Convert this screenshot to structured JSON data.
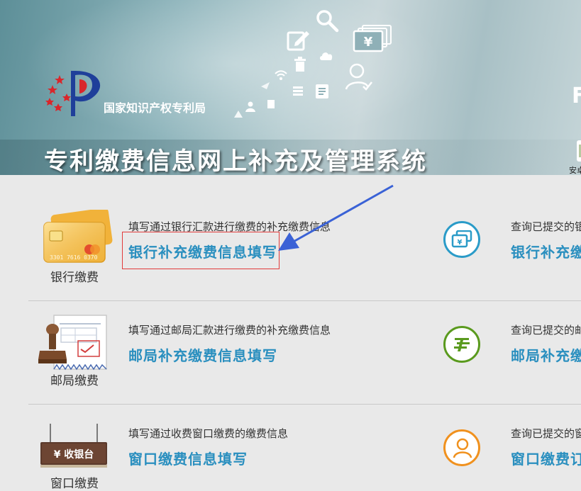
{
  "header": {
    "logo_text": "国家知识产权专利局",
    "system_title": "专利缴费信息网上补充及管理系统",
    "corner_letter": "F",
    "app_label": "安卓"
  },
  "rows": [
    {
      "caption": "银行缴费",
      "description": "填写通过银行汇款进行缴费的补充缴费信息",
      "link": "银行补充缴费信息填写",
      "right_description": "查询已提交的银",
      "right_link": "银行补充缴"
    },
    {
      "caption": "邮局缴费",
      "description": "填写通过邮局汇款进行缴费的补充缴费信息",
      "link": "邮局补充缴费信息填写",
      "right_description": "查询已提交的邮",
      "right_link": "邮局补充缴"
    },
    {
      "caption": "窗口缴费",
      "description": "填写通过收费窗口缴费的缴费信息",
      "link": "窗口缴费信息填写",
      "right_description": "查询已提交的窗",
      "right_link": "窗口缴费订",
      "sign_text": "¥ 收银台"
    }
  ],
  "card_number": "3301 7616 0370",
  "colors": {
    "link": "#2a8fbf",
    "highlight_border": "#e23b3b",
    "arrow": "#3a62d6",
    "bank_icon": "#2a9bc8",
    "post_icon": "#5a9a1e",
    "window_icon": "#f0911e"
  },
  "icons": [
    "bank-card-icon",
    "post-stamp-icon",
    "cashier-sign-icon",
    "yuan-card-icon",
    "post-logo-icon",
    "user-icon",
    "search-icon",
    "edit-icon",
    "money-cards-icon",
    "cloud-icon",
    "wifi-icon",
    "trash-icon",
    "document-icon"
  ]
}
